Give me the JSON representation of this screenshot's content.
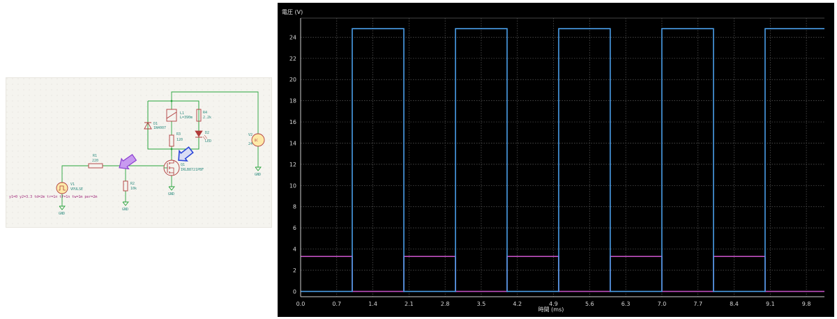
{
  "schematic": {
    "parts": {
      "r1_name": "R1",
      "r1_value": "220",
      "r2_name": "R2",
      "r2_value": "10k",
      "r3_name": "R3",
      "r3_value": "120",
      "r4_name": "R4",
      "r4_value": "2.2k",
      "l1_name": "L1",
      "l1_value": "L=390m",
      "d1_name": "D1",
      "d1_value": "1N4007",
      "d2_name": "D2",
      "d2_value": "LED",
      "q1_name": "Q1",
      "q1_value": "IRLB8721PBF",
      "v1_name": "V1",
      "v1_value": "VPULSE",
      "v2_name": "V2",
      "v2_value": "24",
      "v2_symbol": "DC",
      "v1_params": "y1=0 y2=3.3 td=2m tr=1n tf=1n tw=1m per=2m",
      "gnd_label": "GND"
    },
    "colors": {
      "wire": "#27a33b",
      "part": "#b13b3b",
      "text": "#2a8a7e",
      "arrow_purple": "#b06ee8",
      "arrow_blue": "#2b46d8"
    }
  },
  "scope": {
    "colors": {
      "background": "#000000",
      "grid": "#5c5c5c",
      "blue_trace": "#4a9ee8",
      "purple_trace": "#c04fc0",
      "axis_line": "#cfcfcf"
    }
  },
  "chart_data": {
    "type": "line",
    "xlabel": "時間 (ms)",
    "ylabel": "電圧 (V)",
    "xlim": [
      0,
      10.15
    ],
    "ylim": [
      -0.5,
      25.8
    ],
    "xticks": [
      "0.0",
      "0.7",
      "1.4",
      "2.1",
      "2.8",
      "3.5",
      "4.2",
      "4.9",
      "5.6",
      "6.3",
      "7.0",
      "7.7",
      "8.4",
      "9.1",
      "9.8"
    ],
    "yticks": [
      "0",
      "2",
      "4",
      "6",
      "8",
      "10",
      "12",
      "14",
      "16",
      "18",
      "20",
      "22",
      "24"
    ],
    "grid": true,
    "series": [
      {
        "color": "#4a9ee8",
        "x": [
          0,
          1.0,
          1.0,
          2.0,
          2.0,
          3.0,
          3.0,
          4.0,
          4.0,
          5.0,
          5.0,
          6.0,
          6.0,
          7.0,
          7.0,
          8.0,
          8.0,
          9.0,
          9.0,
          10.15
        ],
        "y": [
          0,
          0,
          24.8,
          24.8,
          0,
          0,
          24.8,
          24.8,
          0,
          0,
          24.8,
          24.8,
          0,
          0,
          24.8,
          24.8,
          0,
          0,
          24.8,
          24.8
        ]
      },
      {
        "color": "#c04fc0",
        "x": [
          0,
          1.0,
          1.0,
          2.0,
          2.0,
          3.0,
          3.0,
          4.0,
          4.0,
          5.0,
          5.0,
          6.0,
          6.0,
          7.0,
          7.0,
          8.0,
          8.0,
          9.0,
          9.0,
          10.15
        ],
        "y": [
          3.3,
          3.3,
          0,
          0,
          3.3,
          3.3,
          0,
          0,
          3.3,
          3.3,
          0,
          0,
          3.3,
          3.3,
          0,
          0,
          3.3,
          3.3,
          0,
          0
        ]
      }
    ]
  }
}
